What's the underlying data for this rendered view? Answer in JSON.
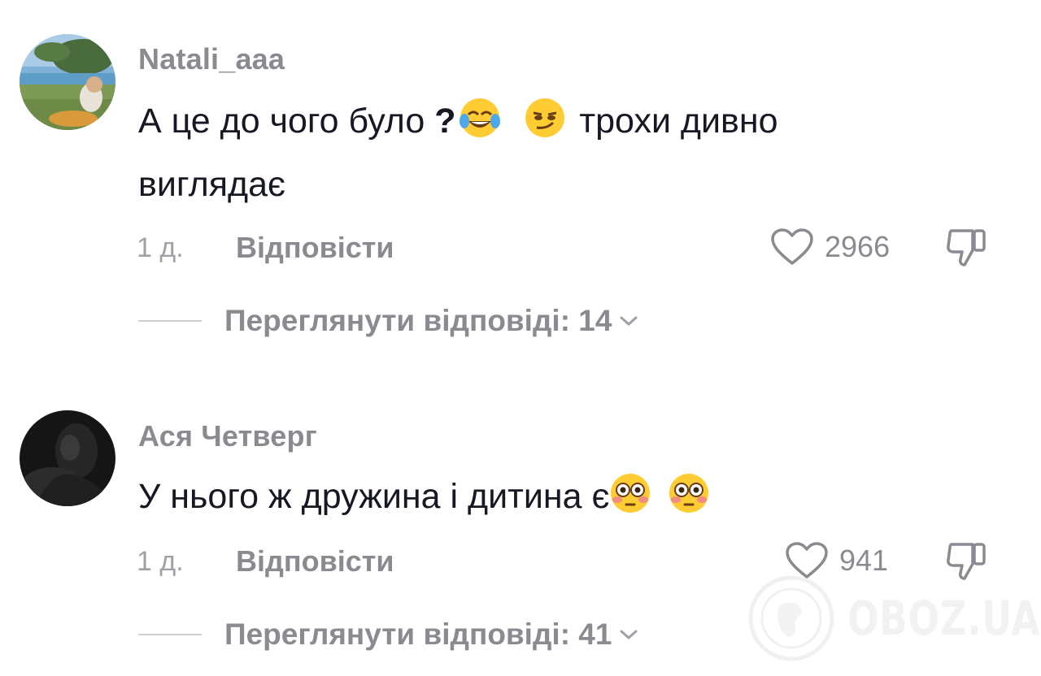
{
  "comments": [
    {
      "username": "Natali_aaa",
      "text_part1": "А це до чого було ",
      "text_qmark": "?",
      "text_part2": " трохи дивно виглядає",
      "emojis": [
        "face-with-tears-of-joy-emoji",
        "smirking-face-emoji"
      ],
      "time": "1 д.",
      "reply_label": "Відповісти",
      "likes": "2966",
      "view_replies_label": "Переглянути відповіді: 14"
    },
    {
      "username": "Ася Четверг",
      "text_part1": "У нього ж дружина і дитина є",
      "emojis": [
        "flushed-face-emoji",
        "flushed-face-emoji"
      ],
      "time": "1 д.",
      "reply_label": "Відповісти",
      "likes": "941",
      "view_replies_label": "Переглянути відповіді: 41"
    }
  ],
  "watermark": {
    "text": "OBOZ.UA"
  },
  "colors": {
    "text": "#161823",
    "secondary": "#8a8b91",
    "muted": "#a0a1a6",
    "divider": "#cfd0d3"
  },
  "icons": {
    "like": "heart-outline-icon",
    "dislike": "thumbs-down-icon",
    "expand": "chevron-down-icon"
  }
}
